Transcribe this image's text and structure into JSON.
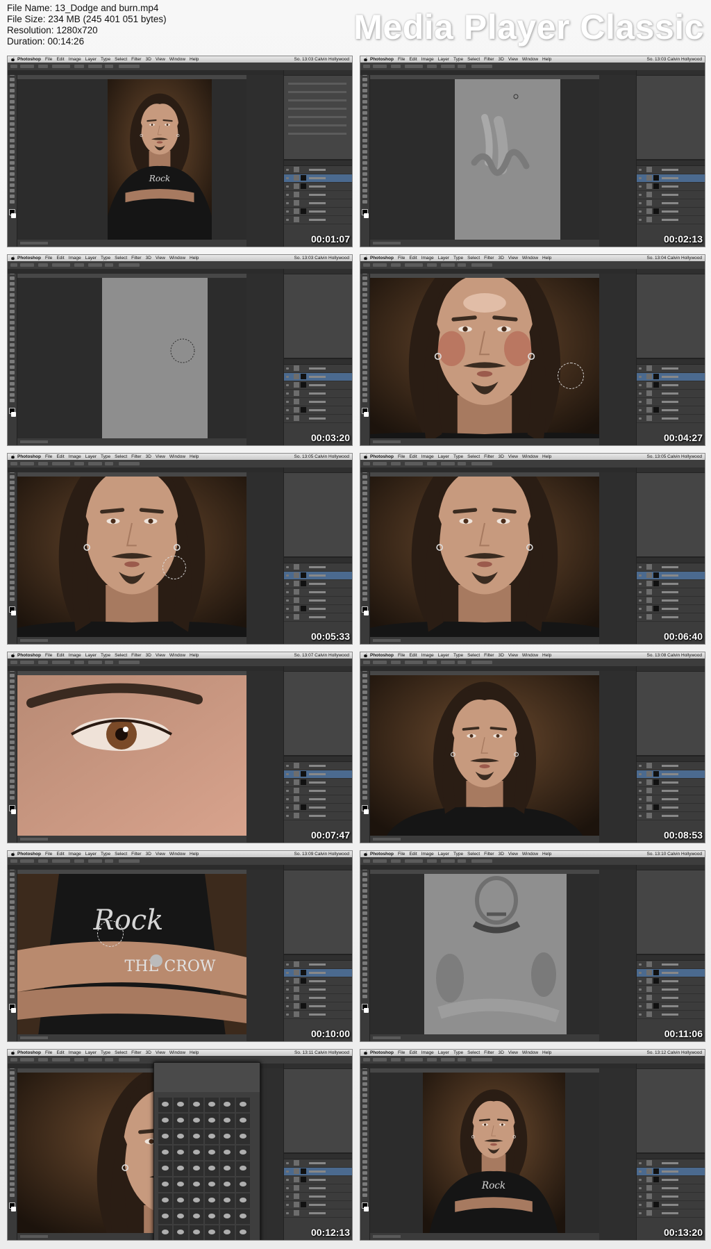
{
  "header": {
    "file_name": "File Name: 13_Dodge and burn.mp4",
    "file_size": "File Size: 234 MB (245 401 051 bytes)",
    "resolution": "Resolution: 1280x720",
    "duration": "Duration: 00:14:26",
    "brand": "Media Player Classic"
  },
  "app": {
    "menus": [
      "Photoshop",
      "File",
      "Edit",
      "Image",
      "Layer",
      "Type",
      "Select",
      "Filter",
      "3D",
      "View",
      "Window",
      "Help"
    ],
    "menu_right": "Calvin Hollywood"
  },
  "thumbnails": [
    {
      "time": "00:01:07",
      "clock": "So. 13:03",
      "scene": "portrait-full"
    },
    {
      "time": "00:02:13",
      "clock": "So. 13:03",
      "scene": "gray-strokes"
    },
    {
      "time": "00:03:20",
      "clock": "So. 13:03",
      "scene": "gray-blank"
    },
    {
      "time": "00:04:27",
      "clock": "So. 13:04",
      "scene": "face-closeup-makeup"
    },
    {
      "time": "00:05:33",
      "clock": "So. 13:05",
      "scene": "face-closeup"
    },
    {
      "time": "00:06:40",
      "clock": "So. 13:05",
      "scene": "face-closeup"
    },
    {
      "time": "00:07:47",
      "clock": "So. 13:07",
      "scene": "eye-macro"
    },
    {
      "time": "00:08:53",
      "clock": "So. 13:08",
      "scene": "face-medium"
    },
    {
      "time": "00:10:00",
      "clock": "So. 13:09",
      "scene": "arms-closeup"
    },
    {
      "time": "00:11:06",
      "clock": "So. 13:10",
      "scene": "gray-map"
    },
    {
      "time": "00:12:13",
      "clock": "So. 13:11",
      "scene": "brush-picker"
    },
    {
      "time": "00:13:20",
      "clock": "So. 13:12",
      "scene": "portrait-medium"
    }
  ]
}
